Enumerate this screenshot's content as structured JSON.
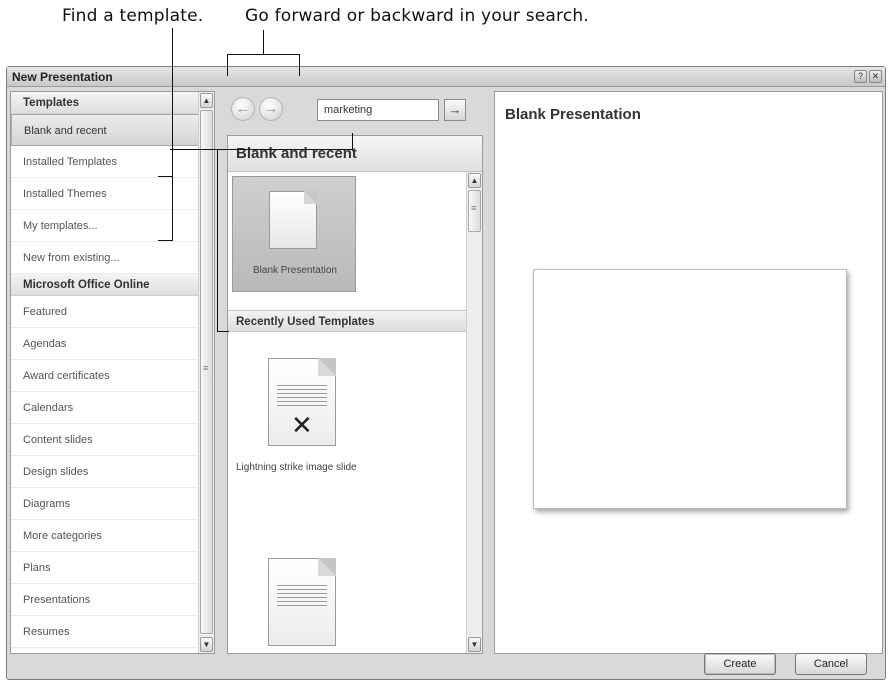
{
  "callouts": {
    "left": "Find a template.",
    "right": "Go forward or backward in your search."
  },
  "window": {
    "title": "New Presentation",
    "help_icon": "?",
    "close_icon": "✕"
  },
  "left_panel": {
    "groups": [
      {
        "header": "Templates",
        "items": [
          "Blank and recent",
          "Installed Templates",
          "Installed Themes",
          "My templates...",
          "New from existing..."
        ]
      },
      {
        "header": "Microsoft Office Online",
        "items": [
          "Featured",
          "Agendas",
          "Award certificates",
          "Calendars",
          "Content slides",
          "Design slides",
          "Diagrams",
          "More categories",
          "Plans",
          "Presentations",
          "Resumes"
        ]
      }
    ],
    "selected": "Blank and recent",
    "scroll_up": "▲",
    "scroll_down": "▼",
    "scroll_grip": "≡"
  },
  "middle_panel": {
    "back_icon": "←",
    "forward_icon": "→",
    "search_value": "marketing",
    "search_go_icon": "→",
    "gallery_title": "Blank and recent",
    "blank_tile_label": "Blank Presentation",
    "section_header": "Recently Used Templates",
    "recent_template_label": "Lightning strike image slide",
    "recent_template_mark": "✕",
    "scroll_up": "▲",
    "scroll_down": "▼",
    "scroll_grip": "≡"
  },
  "right_panel": {
    "preview_title": "Blank Presentation"
  },
  "buttons": {
    "create": "Create",
    "cancel": "Cancel"
  }
}
